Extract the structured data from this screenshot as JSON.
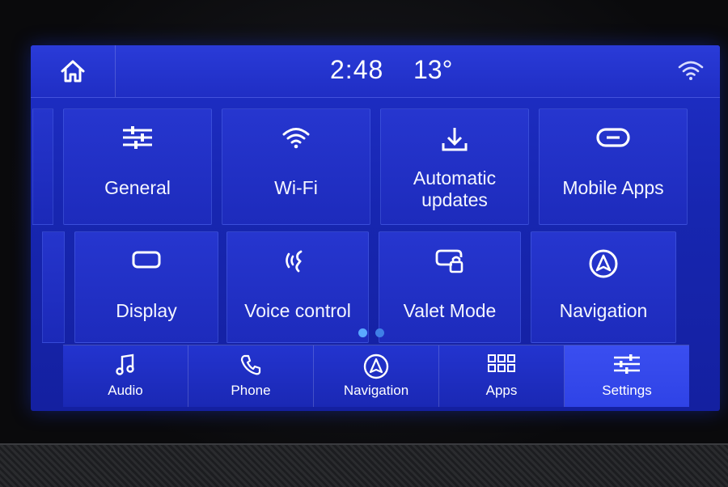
{
  "status_bar": {
    "time": "2:48",
    "temperature": "13°",
    "home_icon": "home-icon",
    "wifi_icon": "wifi-signal-icon"
  },
  "settings_tiles": [
    {
      "label": "General",
      "icon": "sliders-icon"
    },
    {
      "label": "Wi-Fi",
      "icon": "wifi-icon"
    },
    {
      "label_line1": "Automatic",
      "label_line2": "updates",
      "icon": "download-icon"
    },
    {
      "label": "Mobile Apps",
      "icon": "link-icon"
    },
    {
      "label": "Display",
      "icon": "display-icon"
    },
    {
      "label": "Voice control",
      "icon": "voice-icon"
    },
    {
      "label": "Valet Mode",
      "icon": "valet-lock-icon"
    },
    {
      "label": "Navigation",
      "icon": "navigation-icon"
    }
  ],
  "pager": {
    "pages": 2,
    "current": 1
  },
  "bottom_nav": [
    {
      "label": "Audio",
      "icon": "music-note-icon",
      "active": false
    },
    {
      "label": "Phone",
      "icon": "phone-icon",
      "active": false
    },
    {
      "label": "Navigation",
      "icon": "navigation-icon",
      "active": false
    },
    {
      "label": "Apps",
      "icon": "apps-grid-icon",
      "active": false
    },
    {
      "label": "Settings",
      "icon": "sliders-icon",
      "active": true
    }
  ],
  "colors": {
    "screen_blue": "#1726b0",
    "active_tab": "#3a4ef0",
    "pager_dot": "#5aa8ff"
  }
}
